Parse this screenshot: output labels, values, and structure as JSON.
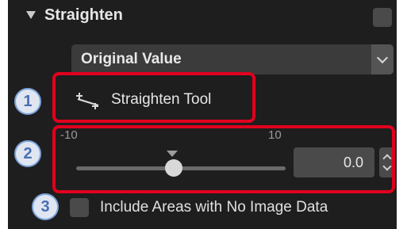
{
  "section": {
    "title": "Straighten"
  },
  "dropdown": {
    "value": "Original Value"
  },
  "straighten_tool": {
    "label": "Straighten Tool"
  },
  "slider": {
    "min_label": "-10",
    "max_label": "10",
    "value": "0.0",
    "level_fraction": 0.5
  },
  "include_areas": {
    "label": "Include Areas with No Image Data",
    "checked": false
  },
  "callouts": [
    "1",
    "2",
    "3"
  ],
  "colors": {
    "panel_background": "#1e1e1e",
    "highlight": "#e0001e",
    "callout_fill": "#dfe6f2",
    "callout_text": "#4a6fb0"
  },
  "icons": [
    "collapse-arrow-icon",
    "chevron-down-icon",
    "straighten-tool-icon",
    "stepper-icon"
  ]
}
